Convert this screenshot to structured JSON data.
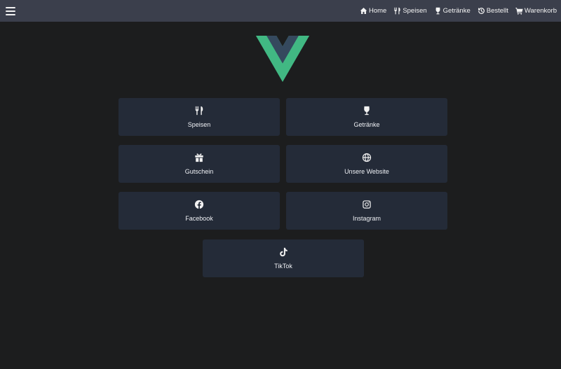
{
  "navbar": {
    "menu_icon": "hamburger-icon",
    "links": [
      {
        "label": "Home",
        "icon": "home-icon"
      },
      {
        "label": "Speisen",
        "icon": "utensils-icon"
      },
      {
        "label": "Getränke",
        "icon": "wine-glass-icon"
      },
      {
        "label": "Bestellt",
        "icon": "history-icon"
      },
      {
        "label": "Warenkorb",
        "icon": "cart-icon"
      }
    ]
  },
  "logo": {
    "name": "vue-logo",
    "colors": {
      "outer": "#41b883",
      "inner": "#35495e"
    }
  },
  "tiles": [
    {
      "label": "Speisen",
      "icon": "utensils-icon"
    },
    {
      "label": "Getränke",
      "icon": "wine-glass-icon"
    },
    {
      "label": "Gutschein",
      "icon": "gift-icon"
    },
    {
      "label": "Unsere Website",
      "icon": "globe-icon"
    },
    {
      "label": "Facebook",
      "icon": "facebook-icon"
    },
    {
      "label": "Instagram",
      "icon": "instagram-icon"
    },
    {
      "label": "TikTok",
      "icon": "tiktok-icon"
    }
  ],
  "colors": {
    "background": "#1c1d1e",
    "navbar": "#3b3f4c",
    "tile": "#242b38"
  }
}
